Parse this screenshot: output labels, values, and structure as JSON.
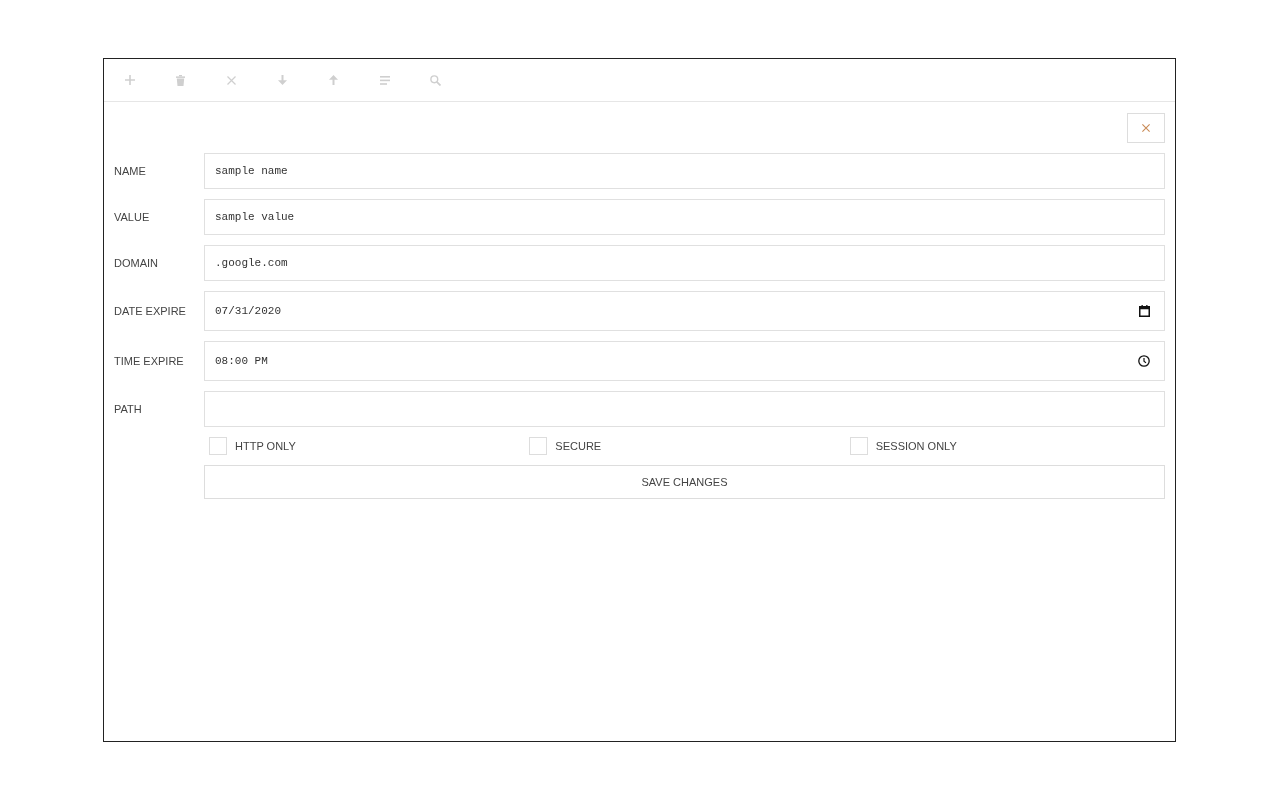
{
  "toolbar": [
    {
      "kind": "add",
      "disabled": true
    },
    {
      "kind": "delete",
      "disabled": true
    },
    {
      "kind": "clear",
      "disabled": true
    },
    {
      "kind": "down",
      "disabled": true
    },
    {
      "kind": "up",
      "disabled": true
    },
    {
      "kind": "list",
      "disabled": true
    },
    {
      "kind": "search",
      "disabled": true
    }
  ],
  "fields": [
    {
      "label": "NAME",
      "kind": "text",
      "value": "sample name"
    },
    {
      "label": "VALUE",
      "kind": "text",
      "value": "sample value"
    },
    {
      "label": "DOMAIN",
      "kind": "text",
      "value": ".google.com"
    },
    {
      "label": "DATE EXPIRE",
      "kind": "date",
      "value": "07/31/2020"
    },
    {
      "label": "TIME EXPIRE",
      "kind": "time",
      "value": "08:00 PM"
    },
    {
      "label": "PATH",
      "kind": "text"
    }
  ],
  "checkboxes": [
    {
      "label": "HTTP ONLY",
      "checked": false
    },
    {
      "label": "SECURE",
      "checked": false
    },
    {
      "label": "SESSION ONLY",
      "checked": false
    }
  ],
  "save_button": {
    "label": "SAVE CHANGES"
  }
}
